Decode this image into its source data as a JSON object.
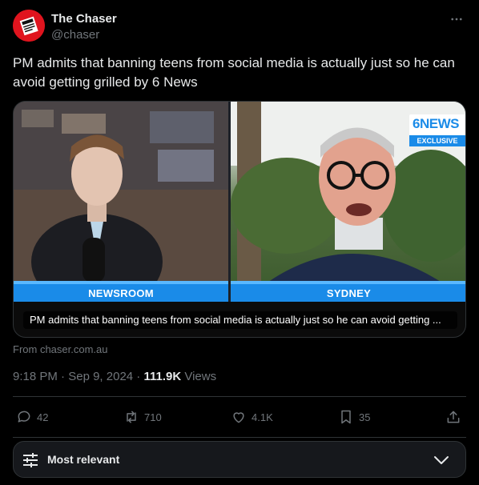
{
  "account": {
    "display_name": "The Chaser",
    "handle": "@chaser"
  },
  "tweet": {
    "text": "PM admits that banning teens from social media is actually just so he can avoid getting grilled by 6 News"
  },
  "card": {
    "left_label": "NEWSROOM",
    "right_label": "SYDNEY",
    "logo_text": "6NEWS",
    "logo_badge": "EXCLUSIVE",
    "caption": "PM admits that banning teens from social media is actually just so he can avoid getting ...",
    "source": "From chaser.com.au"
  },
  "meta": {
    "time": "9:18 PM",
    "dot": "·",
    "date": "Sep 9, 2024",
    "views_count": "111.9K",
    "views_label": "Views"
  },
  "actions": {
    "replies": "42",
    "reposts": "710",
    "likes": "4.1K",
    "bookmarks": "35"
  },
  "sort": {
    "label": "Most relevant"
  },
  "colors": {
    "accent": "#1a8be8",
    "brand_red": "#e0141e",
    "muted": "#71767b"
  },
  "icons": [
    "more-icon",
    "reply-icon",
    "repost-icon",
    "like-icon",
    "bookmark-icon",
    "share-icon",
    "sort-sliders-icon",
    "chevron-down-icon"
  ]
}
